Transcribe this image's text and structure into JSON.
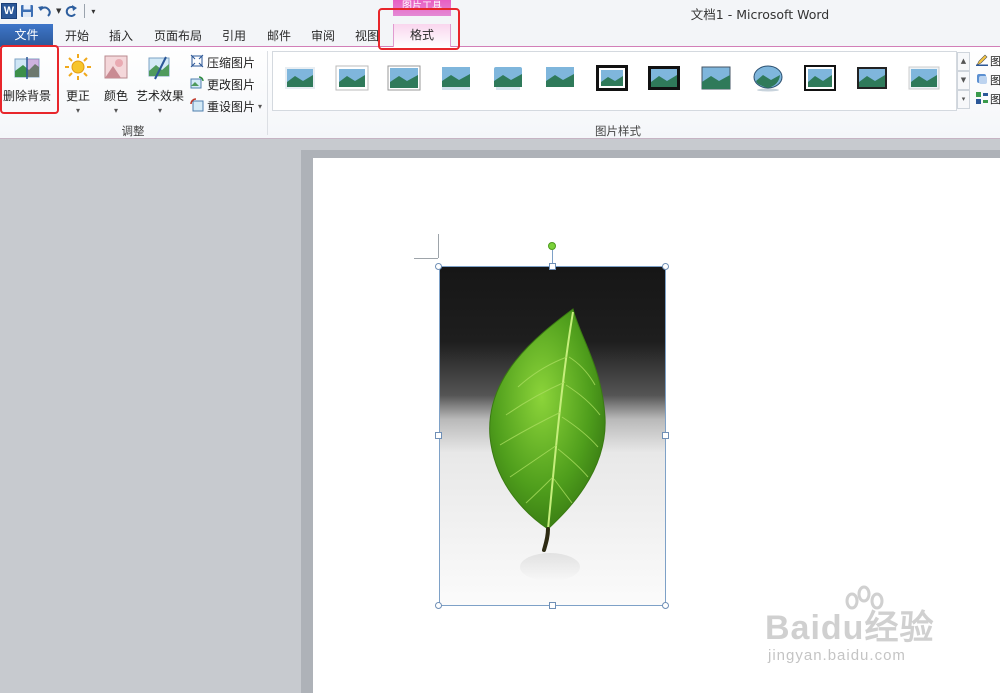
{
  "window": {
    "title": "文档1 - Microsoft Word"
  },
  "quick_access": {
    "icons": [
      "word-logo-icon",
      "save-icon",
      "undo-icon",
      "redo-icon",
      "customize-icon"
    ],
    "logo_letter": "W"
  },
  "tabs": [
    "文件",
    "开始",
    "插入",
    "页面布局",
    "引用",
    "邮件",
    "审阅",
    "视图"
  ],
  "context_tab": {
    "group_label": "图片工具",
    "tab_label": "格式"
  },
  "ribbon": {
    "adjust": {
      "remove_background": "删除背景",
      "corrections": "更正",
      "color": "颜色",
      "artistic_effects": "艺术效果",
      "compress_pictures": "压缩图片",
      "change_picture": "更改图片",
      "reset_picture": "重设图片",
      "group_label": "调整"
    },
    "picture_styles": {
      "group_label": "图片样式",
      "style_count": 13,
      "right_items": [
        "图",
        "图",
        "图"
      ]
    }
  },
  "document": {
    "image_description": "green-leaf-photo"
  },
  "watermark": {
    "brand": "Baidu经验",
    "url": "jingyan.baidu.com"
  },
  "colors": {
    "file_tab": "#2b5797",
    "highlight": "#e8262b",
    "context_tab": "#e85ec2"
  }
}
